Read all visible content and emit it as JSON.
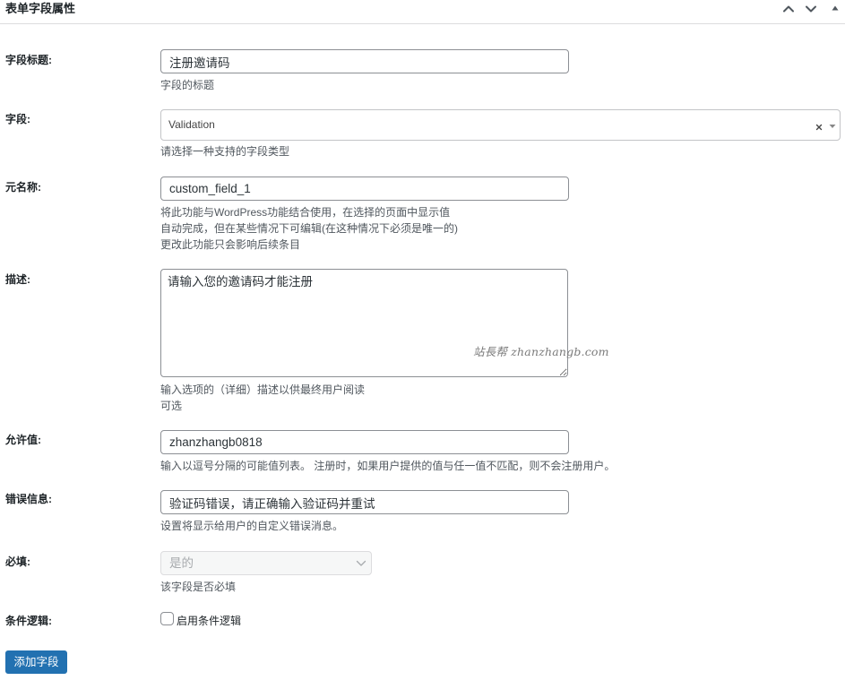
{
  "header": {
    "title": "表单字段属性",
    "icons": {
      "move_up": "move-up-icon",
      "move_down": "move-down-icon",
      "toggle": "toggle-panel-icon"
    }
  },
  "fields": {
    "title": {
      "label": "字段标题:",
      "value": "注册邀请码",
      "description": "字段的标题"
    },
    "field_type": {
      "label": "字段:",
      "value": "Validation",
      "icons": {
        "clear": "clear-icon",
        "arrow": "dropdown-arrow-icon"
      },
      "description": "请选择一种支持的字段类型"
    },
    "meta_name": {
      "label": "元名称:",
      "value": "custom_field_1",
      "description": [
        "将此功能与WordPress功能结合使用，在选择的页面中显示值",
        "自动完成，但在某些情况下可编辑(在这种情况下必须是唯一的)",
        "更改此功能只会影响后续条目"
      ]
    },
    "description": {
      "label": "描述:",
      "value": "请输入您的邀请码才能注册",
      "description": [
        "输入选项的（详细）描述以供最终用户阅读",
        "可选"
      ]
    },
    "allowed_values": {
      "label": "允许值:",
      "value": "zhanzhangb0818",
      "description": "输入以逗号分隔的可能值列表。 注册时，如果用户提供的值与任一值不匹配，则不会注册用户。"
    },
    "error_message": {
      "label": "错误信息:",
      "value": "验证码错误，请正确输入验证码并重试",
      "description": "设置将显示给用户的自定义错误消息。"
    },
    "required": {
      "label": "必填:",
      "value": "是的",
      "disabled": true,
      "description": "该字段是否必填"
    },
    "conditional_logic": {
      "label": "条件逻辑:",
      "checkbox_label": "启用条件逻辑",
      "checked": false
    }
  },
  "add_button": {
    "label": "添加字段"
  },
  "watermark": {
    "text": "站長帮 zhanzhangb.com"
  },
  "colors": {
    "primary_button": "#2271b1",
    "label": "#1d2327",
    "description": "#50575e",
    "input_border": "#8c8f94"
  }
}
